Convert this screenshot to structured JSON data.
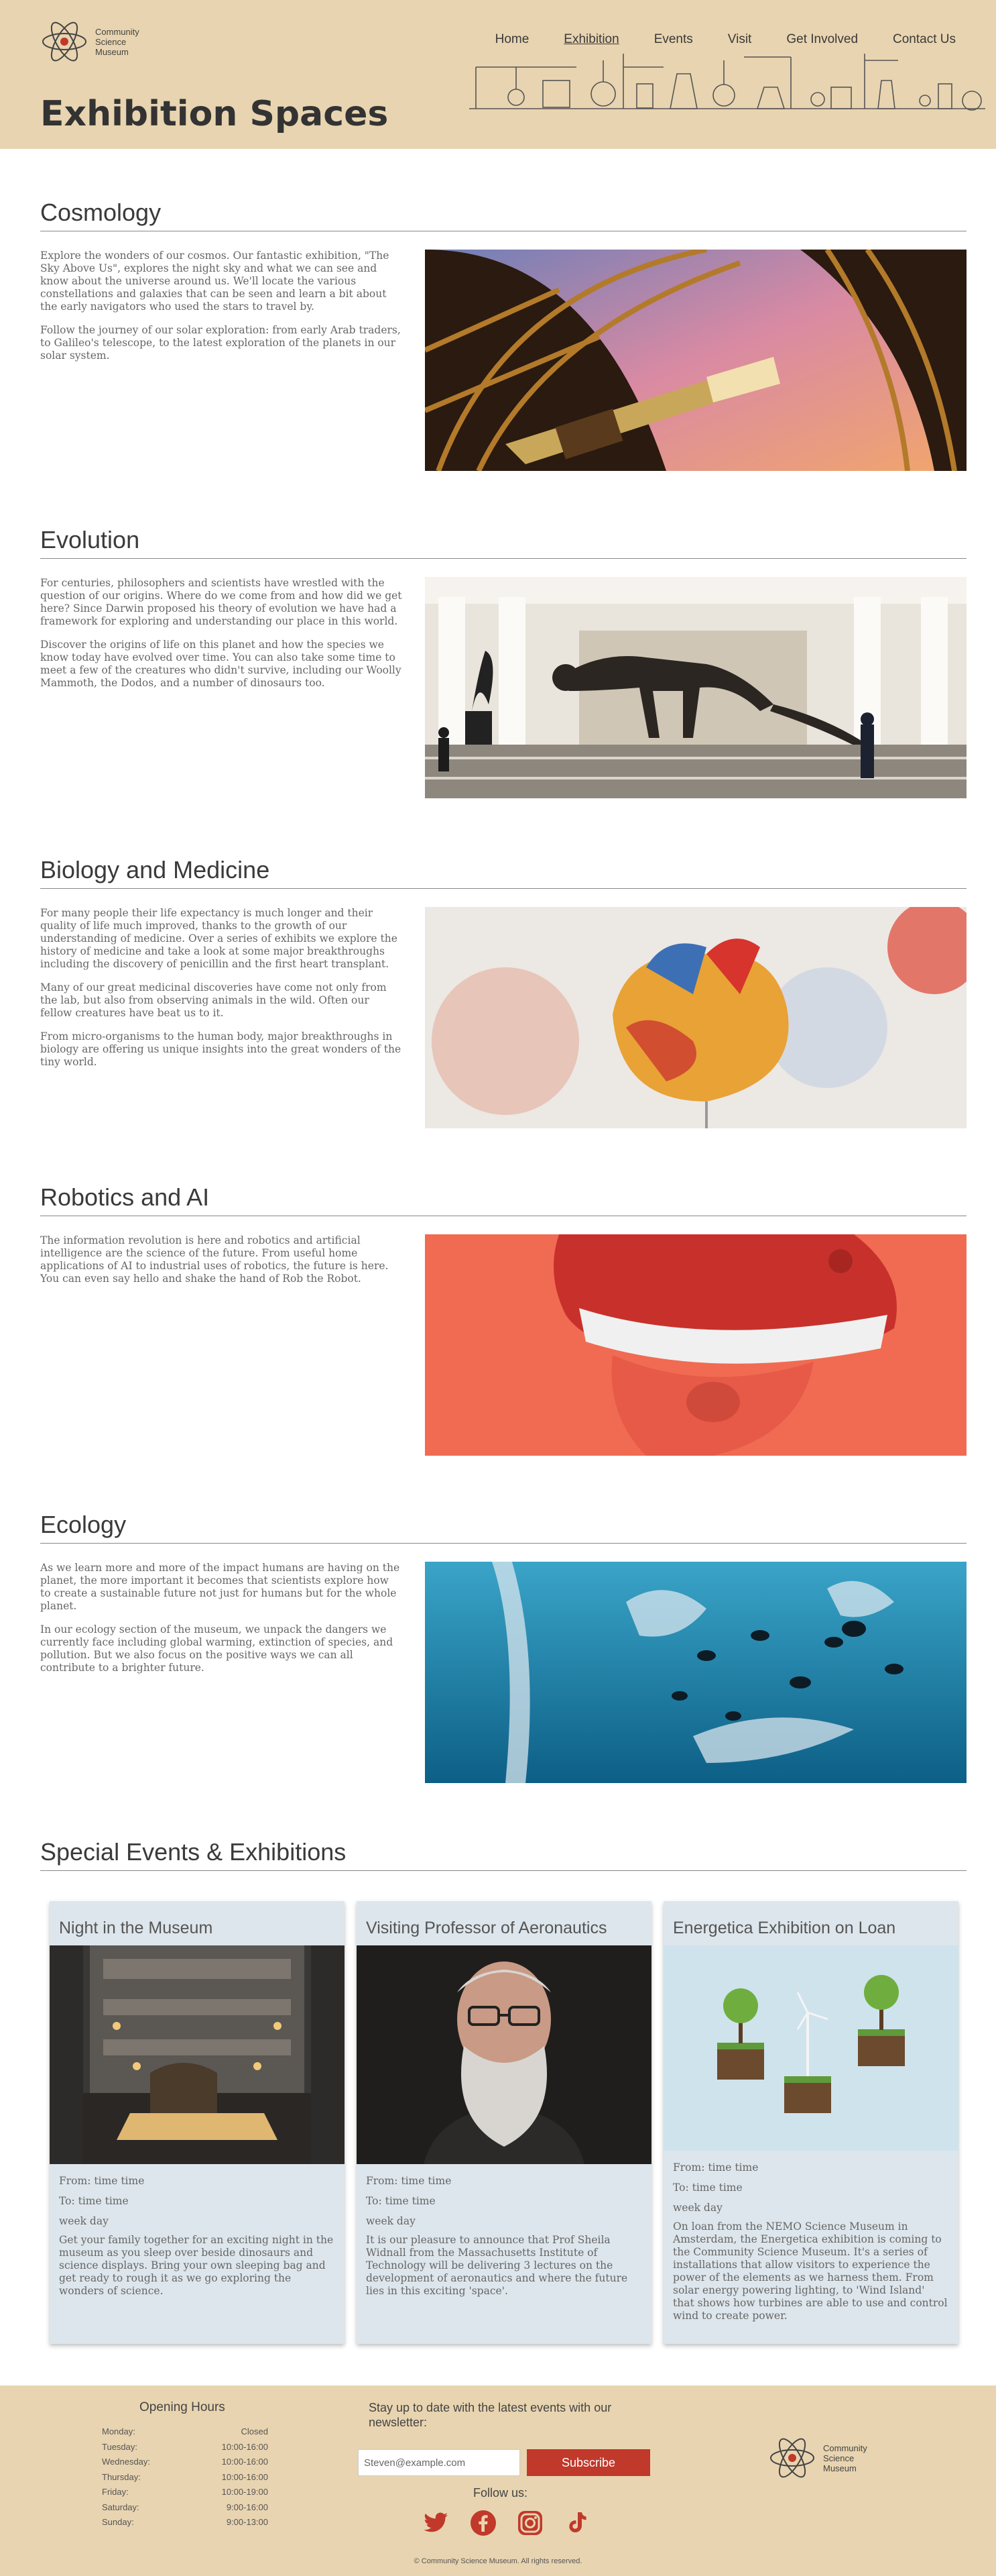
{
  "brand": {
    "name_line1": "Community",
    "name_line2": "Science",
    "name_line3": "Museum"
  },
  "nav": [
    {
      "label": "Home",
      "active": false
    },
    {
      "label": "Exhibition",
      "active": true
    },
    {
      "label": "Events",
      "active": false
    },
    {
      "label": "Visit",
      "active": false
    },
    {
      "label": "Get Involved",
      "active": false
    },
    {
      "label": "Contact Us",
      "active": false
    }
  ],
  "page_title": "Exhibition Spaces",
  "sections": [
    {
      "title": "Cosmology",
      "paragraphs": [
        "Explore the wonders of our cosmos. Our fantastic exhibition, \"The Sky Above Us\", explores the night sky and what we can see and know about the universe around us. We'll locate the various constellations and galaxies that can be seen and learn a bit about the early navigators who used the stars to travel by.",
        "Follow the journey of our solar exploration: from early Arab traders, to Galileo's telescope, to the latest exploration of the planets in our solar system."
      ],
      "image": "telescope-image"
    },
    {
      "title": "Evolution",
      "paragraphs": [
        "For centuries, philosophers and scientists have wrestled with the question of our origins. Where do we come from and how did we get here? Since Darwin proposed his theory of evolution we have had a framework for exploring and understanding our place in this world.",
        "Discover the origins of life on this planet and how the species we know today have evolved over time. You can also take some time to meet a few of the creatures who didn't survive, including our Woolly Mammoth, the Dodos, and a number of dinosaurs too."
      ],
      "image": "dinosaur-skeleton-image"
    },
    {
      "title": "Biology and Medicine",
      "paragraphs": [
        "For many people their life expectancy is much longer and their quality of life much improved, thanks to the growth of our understanding of medicine. Over a series of exhibits we explore the history of medicine and take a look at some major breakthroughs including the discovery of penicillin and the first heart transplant.",
        "Many of our great medicinal discoveries have come not only from the lab, but also from observing animals in the wild. Often our fellow creatures have beat us to it.",
        "From micro-organisms to the human body, major breakthroughs in biology are offering us unique insights into the great wonders of the tiny world."
      ],
      "image": "heart-model-image"
    },
    {
      "title": "Robotics and AI",
      "paragraphs": [
        "The information revolution is here and robotics and artificial intelligence are the science of the future. From useful home applications of AI to industrial uses of robotics, the future is here. You can even say hello and shake the hand of Rob the Robot."
      ],
      "image": "vr-headset-image"
    },
    {
      "title": "Ecology",
      "paragraphs": [
        "As we learn more and more of the impact humans are having on the planet, the more important it becomes that scientists explore how to create a sustainable future not just for humans but for the whole planet.",
        "In our ecology section of the museum, we unpack the dangers we currently face including global warming, extinction of species, and pollution. But we also focus on the positive ways we can all contribute to a brighter future."
      ],
      "image": "ocean-plastic-image"
    }
  ],
  "events_title": "Special Events & Exhibitions",
  "events": [
    {
      "title": "Night in the Museum",
      "from": "From: time time",
      "to": "To: time time",
      "day": "week day",
      "description": "Get your family together for an exciting night in the museum as you sleep over beside dinosaurs and science displays. Bring your own sleeping bag and get ready to rough it as we go exploring the wonders of science."
    },
    {
      "title": "Visiting Professor of Aeronautics",
      "from": "From: time time",
      "to": "To: time time",
      "day": "week day",
      "description": "It is our pleasure to announce that Prof Sheila Widnall from the Massachusetts Institute of Technology will be delivering 3 lectures on the development of aeronautics and where the future lies in this exciting 'space'."
    },
    {
      "title": "Energetica Exhibition on Loan",
      "from": "From: time time",
      "to": "To: time time",
      "day": "week day",
      "description": "On loan from the NEMO Science Museum in Amsterdam, the Energetica exhibition is coming to the Community Science Museum. It's a series of installations that allow visitors to experience the power of the elements as we harness them. From solar energy powering lighting, to 'Wind Island' that shows how turbines are able to use and control wind to create power."
    }
  ],
  "footer": {
    "hours_title": "Opening Hours",
    "hours": [
      {
        "day": "Monday:",
        "time": "Closed"
      },
      {
        "day": "Tuesday:",
        "time": "10:00-16:00"
      },
      {
        "day": "Wednesday:",
        "time": "10:00-16:00"
      },
      {
        "day": "Thursday:",
        "time": "10:00-16:00"
      },
      {
        "day": "Friday:",
        "time": "10:00-19:00"
      },
      {
        "day": "Saturday:",
        "time": "9:00-16:00"
      },
      {
        "day": "Sunday:",
        "time": "9:00-13:00"
      }
    ],
    "newsletter_text": "Stay up to date with the latest events with our newsletter:",
    "email_placeholder": "Steven@example.com",
    "subscribe_label": "Subscribe",
    "follow_label": "Follow us:",
    "socials": [
      "twitter-icon",
      "facebook-icon",
      "instagram-icon",
      "tiktok-icon"
    ],
    "copyright": "© Community Science Museum. All rights reserved."
  },
  "colors": {
    "header_bg": "#e8d4b0",
    "accent_red": "#c0392b",
    "card_bg": "#dde6ec",
    "text": "#666666"
  }
}
